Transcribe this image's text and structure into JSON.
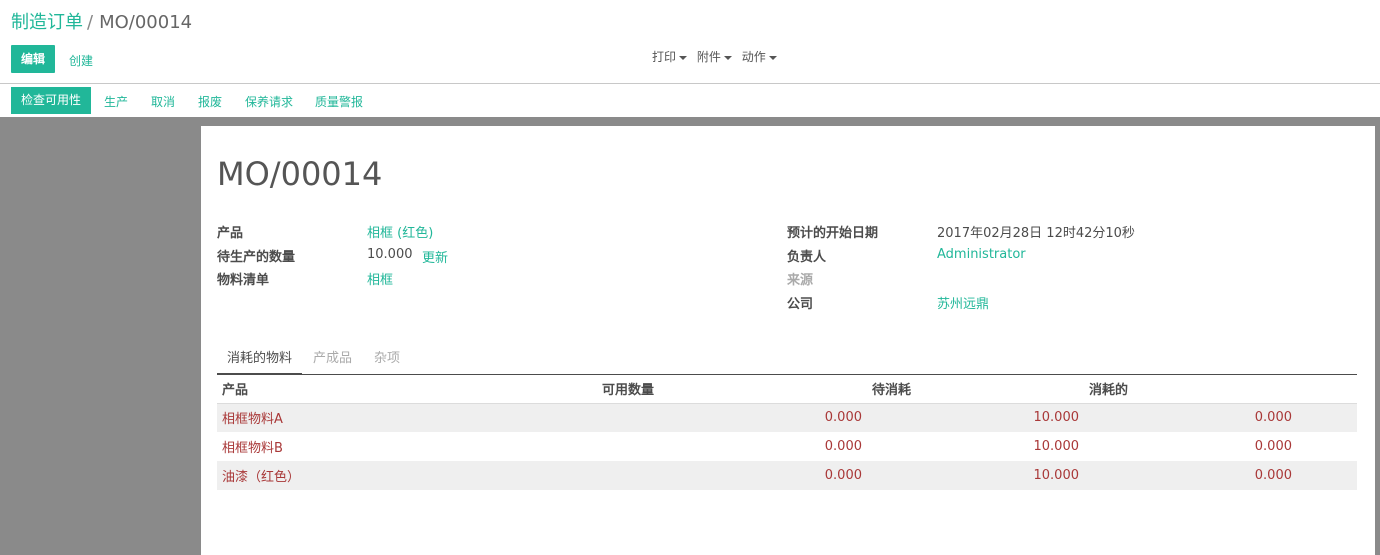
{
  "breadcrumb": {
    "parent": "制造订单",
    "separator": "/",
    "current": "MO/00014"
  },
  "buttons": {
    "edit": "编辑",
    "create": "创建"
  },
  "menus": [
    {
      "label": "打印"
    },
    {
      "label": "附件"
    },
    {
      "label": "动作"
    }
  ],
  "status_bar": {
    "primary": "检查可用性",
    "links": [
      "生产",
      "取消",
      "报废",
      "保养请求",
      "质量警报"
    ]
  },
  "form": {
    "title": "MO/00014",
    "left": {
      "product_label": "产品",
      "product_value": "相框 (红色)",
      "qty_label": "待生产的数量",
      "qty_value": "10.000",
      "qty_update": "更新",
      "bom_label": "物料清单",
      "bom_value": "相框"
    },
    "right": {
      "date_label": "预计的开始日期",
      "date_value": "2017年02月28日 12时42分10秒",
      "owner_label": "负责人",
      "owner_value": "Administrator",
      "source_label": "来源",
      "company_label": "公司",
      "company_value": "苏州远鼎"
    }
  },
  "tabs": [
    "消耗的物料",
    "产成品",
    "杂项"
  ],
  "table": {
    "headers": [
      "产品",
      "可用数量",
      "待消耗",
      "消耗的"
    ],
    "rows": [
      {
        "product": "相框物料A",
        "available": "0.000",
        "to_consume": "10.000",
        "consumed": "0.000"
      },
      {
        "product": "相框物料B",
        "available": "0.000",
        "to_consume": "10.000",
        "consumed": "0.000"
      },
      {
        "product": "油漆（红色）",
        "available": "0.000",
        "to_consume": "10.000",
        "consumed": "0.000"
      }
    ]
  },
  "colors": {
    "accent": "#21b799",
    "line_text": "#a93838",
    "background": "#8a8a8a"
  }
}
